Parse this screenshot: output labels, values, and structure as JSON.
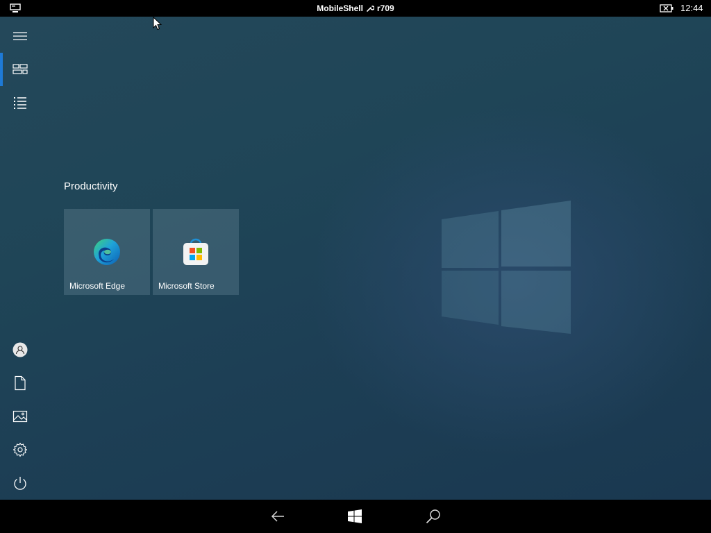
{
  "statusbar": {
    "title": "MobileShell",
    "build": "r709",
    "time": "12:44",
    "network_icon": "network-icon",
    "battery_icon": "battery-icon"
  },
  "rail": {
    "items": [
      {
        "name": "hamburger-menu",
        "icon": "hamburger-icon"
      },
      {
        "name": "tiles-view",
        "icon": "tiles-icon",
        "active": true
      },
      {
        "name": "all-apps-list",
        "icon": "list-icon"
      },
      {
        "name": "user-account",
        "icon": "user-icon"
      },
      {
        "name": "documents",
        "icon": "document-icon"
      },
      {
        "name": "pictures",
        "icon": "pictures-icon"
      },
      {
        "name": "settings",
        "icon": "gear-icon"
      },
      {
        "name": "power",
        "icon": "power-icon"
      }
    ]
  },
  "start": {
    "group_title": "Productivity",
    "tiles": [
      {
        "label": "Microsoft Edge",
        "icon": "edge-icon"
      },
      {
        "label": "Microsoft Store",
        "icon": "store-icon"
      }
    ]
  },
  "navbar": {
    "buttons": [
      {
        "name": "back",
        "icon": "back-arrow-icon"
      },
      {
        "name": "start",
        "icon": "windows-logo-icon"
      },
      {
        "name": "search",
        "icon": "search-icon"
      }
    ]
  },
  "colors": {
    "accent": "#1e7ad6",
    "desktop": "#1f4557",
    "bars": "#000000"
  }
}
